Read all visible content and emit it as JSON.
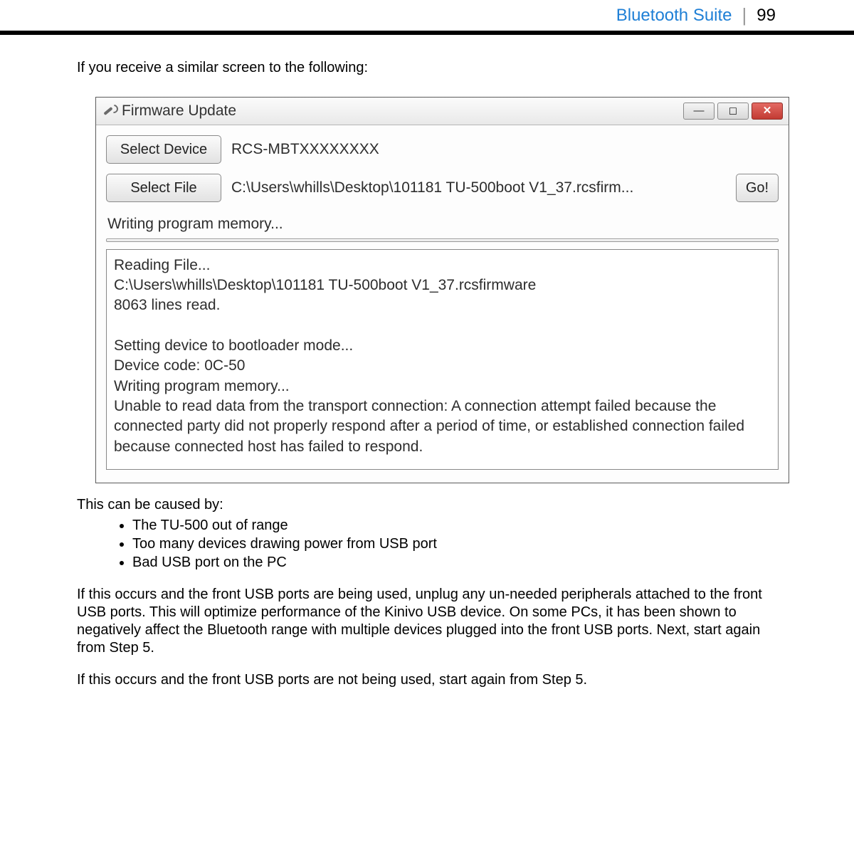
{
  "header": {
    "section": "Bluetooth Suite",
    "page": "99"
  },
  "intro": "If you receive a similar screen to the following:",
  "window": {
    "title": "Firmware Update",
    "select_device_btn": "Select Device",
    "device_value": "RCS-MBTXXXXXXXX",
    "select_file_btn": "Select File",
    "file_value": "C:\\Users\\whills\\Desktop\\101181 TU-500boot V1_37.rcsfirm...",
    "go_btn": "Go!",
    "status": "Writing program memory...",
    "log": "Reading File...\nC:\\Users\\whills\\Desktop\\101181 TU-500boot V1_37.rcsfirmware\n8063 lines read.\n\nSetting device to bootloader mode...\nDevice code: 0C-50\nWriting program memory...\nUnable to read data from the transport connection: A connection attempt failed because the connected party did not properly respond after a period of time, or established connection failed because connected host has failed to respond."
  },
  "causes_intro": "This can be caused by:",
  "causes": [
    "The TU-500 out of range",
    "Too many devices drawing power from USB port",
    "Bad USB port on the PC"
  ],
  "para1": "If this occurs and the front USB ports are being used, unplug any un-needed peripherals attached to the front USB ports. This will optimize performance of the Kinivo USB device. On some PCs, it has been shown to negatively affect the Bluetooth range with multiple devices plugged into the front USB ports. Next, start again from Step 5.",
  "para2": "If this occurs and the front USB ports are not being used, start again from Step 5."
}
